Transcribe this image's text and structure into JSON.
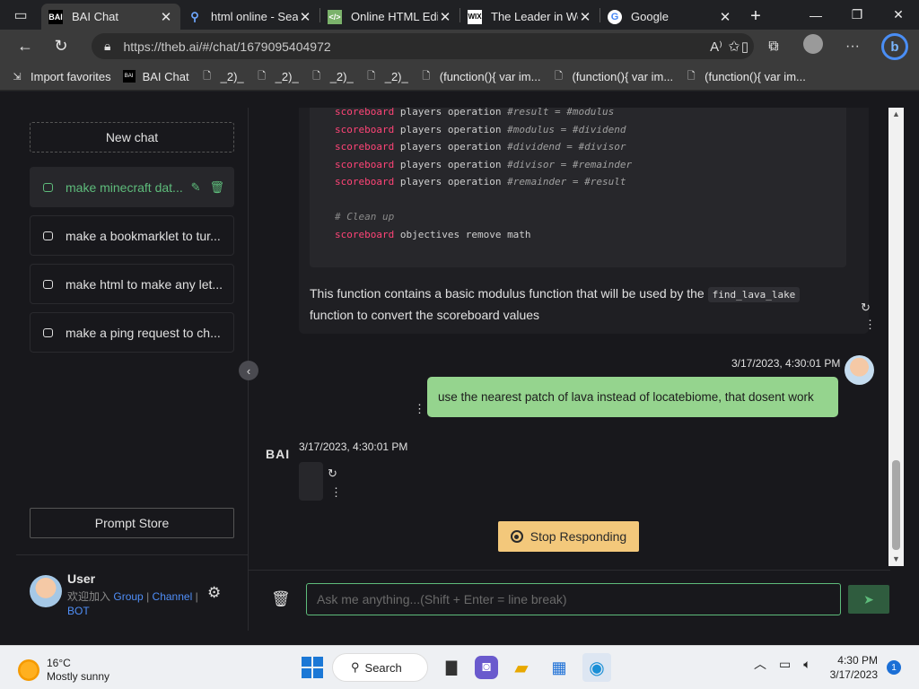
{
  "browser": {
    "tabs": [
      {
        "title": "BAI Chat",
        "icon": "bai-icon"
      },
      {
        "title": "html online - Sea",
        "icon": "search-icon"
      },
      {
        "title": "Online HTML Edito",
        "icon": "code-editor-icon"
      },
      {
        "title": "The Leader in Web",
        "icon": "wix-icon"
      },
      {
        "title": "Google",
        "icon": "google-icon"
      }
    ],
    "url": "https://theb.ai/#/chat/1679095404972",
    "favorites": [
      {
        "label": "Import favorites"
      },
      {
        "label": "BAI Chat"
      },
      {
        "label": "_2)_"
      },
      {
        "label": "_2)_"
      },
      {
        "label": "_2)_"
      },
      {
        "label": "_2)_"
      },
      {
        "label": "(function(){   var im..."
      },
      {
        "label": "(function(){   var im..."
      },
      {
        "label": "(function(){   var im..."
      }
    ]
  },
  "sidebar": {
    "new_chat": "New chat",
    "history": [
      {
        "label": "make minecraft dat..."
      },
      {
        "label": "make a bookmarklet to tur..."
      },
      {
        "label": "make html to make any let..."
      },
      {
        "label": "make a ping request to ch..."
      }
    ],
    "prompt_store": "Prompt Store",
    "user": {
      "name": "User",
      "prefix": "欢迎加入",
      "link1": "Group",
      "sep": "|",
      "link2": "Channel",
      "link3": "BOT"
    }
  },
  "chat": {
    "code_lines": [
      {
        "kw": "scoreboard",
        "rest": " players operation ",
        "v": "#result = #modulus"
      },
      {
        "kw": "scoreboard",
        "rest": " players operation ",
        "v": "#modulus = #dividend"
      },
      {
        "kw": "scoreboard",
        "rest": " players operation ",
        "v": "#dividend = #divisor"
      },
      {
        "kw": "scoreboard",
        "rest": " players operation ",
        "v": "#divisor = #remainder"
      },
      {
        "kw": "scoreboard",
        "rest": " players operation ",
        "v": "#remainder = #result"
      }
    ],
    "code_comment": "# Clean up",
    "code_last_kw": "scoreboard",
    "code_last_rest": " objectives remove math",
    "answer_part1": "This function contains a basic modulus function that will be used by the ",
    "answer_code": "find_lava_lake",
    "answer_part2": "function to convert the scoreboard values",
    "user_timestamp": "3/17/2023, 4:30:01 PM",
    "user_message": "use the nearest patch of lava instead of locatebiome, that dosent work",
    "bot_name": "BAI",
    "bot_timestamp": "3/17/2023, 4:30:01 PM",
    "stop_label": "Stop Responding",
    "input_placeholder": "Ask me anything...(Shift + Enter = line break)"
  },
  "taskbar": {
    "temp": "16°C",
    "weather": "Mostly sunny",
    "search": "Search",
    "time": "4:30 PM",
    "date": "3/17/2023",
    "notifications": "1"
  },
  "colors": {
    "accent_green": "#5ebc7b",
    "user_bubble": "#95d48e",
    "stop_button": "#f3c87b",
    "keyword_pink": "#ff4477",
    "link_blue": "#4f8ef7"
  }
}
